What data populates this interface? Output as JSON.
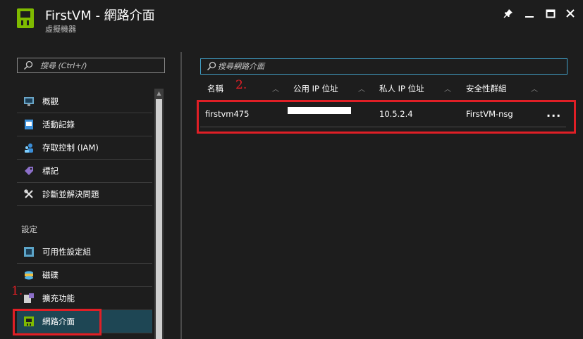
{
  "window": {
    "title": "FirstVM - 網路介面",
    "subtitle": "虛擬機器",
    "pin_icon": "pin-icon",
    "minimize_icon": "minimize-icon",
    "maximize_icon": "maximize-icon",
    "close_icon": "close-icon"
  },
  "sidebar": {
    "search_placeholder": "搜尋 (Ctrl+/)",
    "items": [
      {
        "label": "概觀",
        "icon": "overview-icon"
      },
      {
        "label": "活動記錄",
        "icon": "activity-log-icon"
      },
      {
        "label": "存取控制 (IAM)",
        "icon": "access-control-icon"
      },
      {
        "label": "標記",
        "icon": "tag-icon"
      },
      {
        "label": "診斷並解決問題",
        "icon": "wrench-icon"
      }
    ],
    "section_settings": "設定",
    "settings_items": [
      {
        "label": "可用性設定組",
        "icon": "availability-set-icon"
      },
      {
        "label": "磁碟",
        "icon": "disk-icon"
      },
      {
        "label": "擴充功能",
        "icon": "extensions-icon"
      },
      {
        "label": "網路介面",
        "icon": "network-interface-icon",
        "active": true
      }
    ]
  },
  "main": {
    "search_placeholder": "搜尋網路介面",
    "columns": [
      "名稱",
      "公用 IP 位址",
      "私人 IP 位址",
      "安全性群組"
    ],
    "rows": [
      {
        "name": "firstvm475",
        "public_ip": "",
        "private_ip": "10.5.2.4",
        "nsg": "FirstVM-nsg",
        "more": "..."
      }
    ]
  },
  "annotations": {
    "step1": "1.",
    "step2": "2."
  },
  "colors": {
    "background": "#1d1d1d",
    "accent": "#41a0c8",
    "active_item": "#1e4654",
    "annotation_red": "#e01f26",
    "vm_icon": "#7fba00"
  }
}
